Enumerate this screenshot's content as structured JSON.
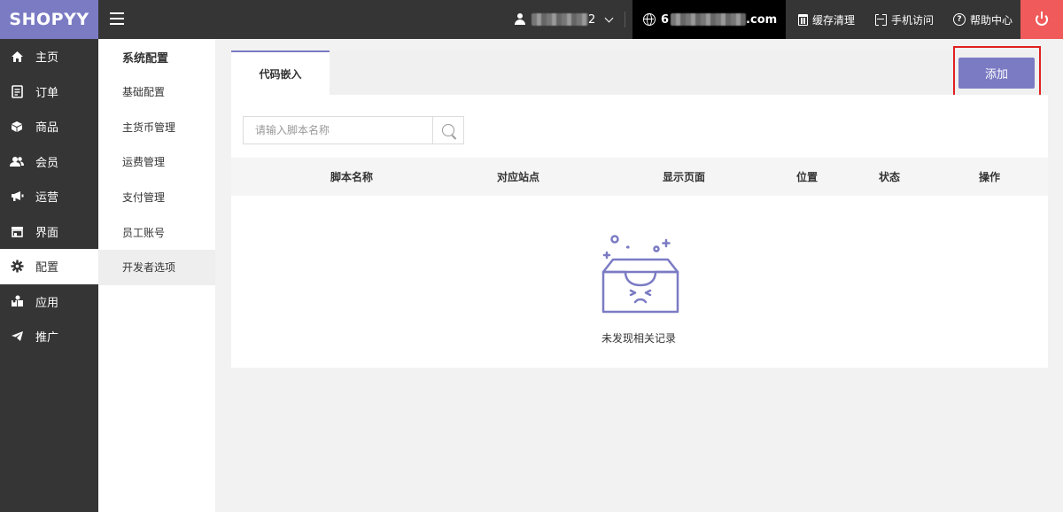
{
  "topbar": {
    "logo": "SHOPYY",
    "user_suffix": "2",
    "domain_suffix": ".com",
    "domain_prefix": "6",
    "actions": {
      "cache_clear": "缓存清理",
      "mobile_visit": "手机访问",
      "help_center": "帮助中心"
    }
  },
  "sidebar": {
    "items": [
      {
        "label": "主页",
        "icon": "home-icon"
      },
      {
        "label": "订单",
        "icon": "order-icon"
      },
      {
        "label": "商品",
        "icon": "product-icon"
      },
      {
        "label": "会员",
        "icon": "member-icon"
      },
      {
        "label": "运营",
        "icon": "megaphone-icon"
      },
      {
        "label": "界面",
        "icon": "storefront-icon"
      },
      {
        "label": "配置",
        "icon": "gear-icon",
        "active": true
      },
      {
        "label": "应用",
        "icon": "apps-icon"
      },
      {
        "label": "推广",
        "icon": "paper-plane-icon"
      }
    ]
  },
  "submenu": {
    "title": "系统配置",
    "items": [
      {
        "label": "基础配置"
      },
      {
        "label": "主货币管理"
      },
      {
        "label": "运费管理"
      },
      {
        "label": "支付管理"
      },
      {
        "label": "员工账号"
      },
      {
        "label": "开发者选项",
        "active": true
      }
    ]
  },
  "main": {
    "tab": "代码嵌入",
    "add_button": "添加",
    "search": {
      "placeholder": "请输入脚本名称",
      "value": ""
    },
    "table": {
      "columns": [
        "脚本名称",
        "对应站点",
        "显示页面",
        "位置",
        "状态",
        "操作"
      ]
    },
    "empty_text": "未发现相关记录"
  },
  "colors": {
    "accent": "#7b7bc4",
    "topbar": "#353535",
    "power": "#f05a5a",
    "highlight": "#e02020"
  }
}
